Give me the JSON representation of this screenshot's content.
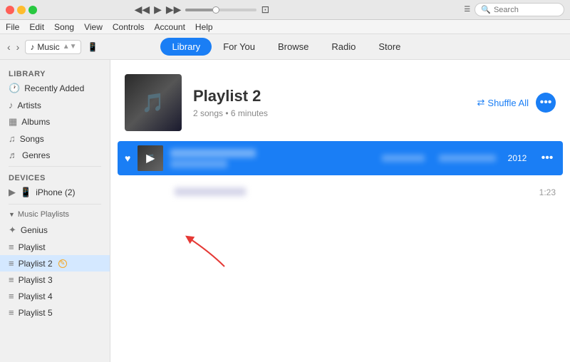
{
  "titlebar": {
    "transport": {
      "prev": "◀◀",
      "play": "▶",
      "next": "▶▶"
    },
    "apple_logo": "",
    "search_placeholder": "Search"
  },
  "menubar": {
    "items": [
      "File",
      "Edit",
      "Song",
      "View",
      "Controls",
      "Account",
      "Help"
    ]
  },
  "navbar": {
    "back": "<",
    "forward": ">",
    "music_label": "Music",
    "phone_icon": "📱",
    "tabs": [
      "Library",
      "For You",
      "Browse",
      "Radio",
      "Store"
    ],
    "active_tab": "Library"
  },
  "sidebar": {
    "library_title": "Library",
    "library_items": [
      {
        "label": "Recently Added",
        "icon": "🕐"
      },
      {
        "label": "Artists",
        "icon": "👤"
      },
      {
        "label": "Albums",
        "icon": "🎵"
      },
      {
        "label": "Songs",
        "icon": "🎵"
      },
      {
        "label": "Genres",
        "icon": "🎵"
      }
    ],
    "devices_title": "Devices",
    "devices_items": [
      {
        "label": "iPhone (2)",
        "icon": "📱"
      }
    ],
    "playlists_title": "Music Playlists",
    "playlists_items": [
      {
        "label": "Genius",
        "icon": "✦"
      },
      {
        "label": "Playlist",
        "icon": "≡"
      },
      {
        "label": "Playlist 2",
        "icon": "≡",
        "active": true
      },
      {
        "label": "Playlist 3",
        "icon": "≡"
      },
      {
        "label": "Playlist 4",
        "icon": "≡"
      },
      {
        "label": "Playlist 5",
        "icon": "≡"
      }
    ]
  },
  "content": {
    "playlist_title": "Playlist 2",
    "playlist_meta": "2 songs • 6 minutes",
    "shuffle_label": "Shuffle All",
    "more_label": "•••",
    "tracks": [
      {
        "id": 1,
        "highlighted": true,
        "has_heart": true,
        "has_thumb": true,
        "title_blurred": true,
        "year": "2012",
        "time": "",
        "has_more": true
      },
      {
        "id": 2,
        "highlighted": false,
        "has_heart": false,
        "has_thumb": false,
        "title_blurred": true,
        "year": "",
        "time": "1:23",
        "has_more": false
      }
    ]
  },
  "annotation": {
    "arrow_label": "→"
  }
}
